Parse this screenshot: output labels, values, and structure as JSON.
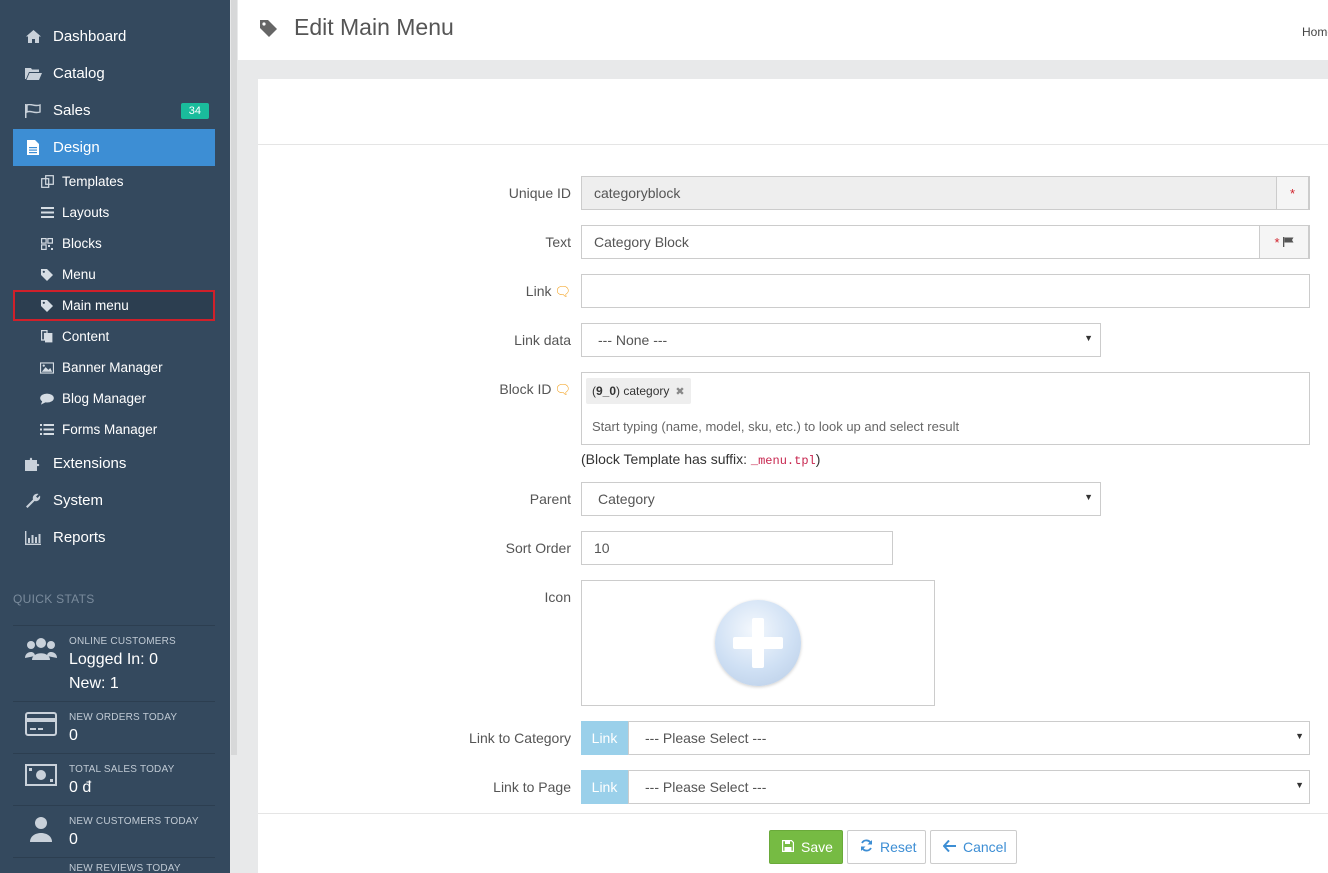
{
  "sidebar": {
    "nav": [
      {
        "label": "Dashboard",
        "icon": "home-icon"
      },
      {
        "label": "Catalog",
        "icon": "folder-open-icon"
      },
      {
        "label": "Sales",
        "icon": "flag-icon",
        "badge": "34"
      },
      {
        "label": "Design",
        "icon": "file-icon"
      }
    ],
    "design_sub": [
      {
        "label": "Templates",
        "icon": "templates-icon"
      },
      {
        "label": "Layouts",
        "icon": "bars-icon"
      },
      {
        "label": "Blocks",
        "icon": "qrcode-icon"
      },
      {
        "label": "Menu",
        "icon": "tag-icon"
      },
      {
        "label": "Main menu",
        "icon": "tag-icon"
      },
      {
        "label": "Content",
        "icon": "copy-icon"
      },
      {
        "label": "Banner Manager",
        "icon": "image-icon"
      },
      {
        "label": "Blog Manager",
        "icon": "comment-icon"
      },
      {
        "label": "Forms Manager",
        "icon": "list-icon"
      }
    ],
    "nav_bottom": [
      {
        "label": "Extensions",
        "icon": "puzzle-icon"
      },
      {
        "label": "System",
        "icon": "wrench-icon"
      },
      {
        "label": "Reports",
        "icon": "bar-chart-icon"
      }
    ],
    "quick_stats_title": "QUICK STATS",
    "stats": [
      {
        "label": "ONLINE CUSTOMERS",
        "line1": "Logged In: 0",
        "line2": "New: 1"
      },
      {
        "label": "NEW ORDERS TODAY",
        "value": "0"
      },
      {
        "label": "TOTAL SALES TODAY",
        "value": "0 đ"
      },
      {
        "label": "NEW CUSTOMERS TODAY",
        "value": "0"
      },
      {
        "label": "NEW REVIEWS TODAY"
      }
    ]
  },
  "header": {
    "title": "Edit Main Menu",
    "breadcrumb": "Home"
  },
  "form": {
    "unique_id": {
      "label": "Unique ID",
      "value": "categoryblock",
      "required": "*"
    },
    "text": {
      "label": "Text",
      "value": "Category Block",
      "required": "*"
    },
    "link": {
      "label": "Link",
      "value": ""
    },
    "link_data": {
      "label": "Link data",
      "value": "--- None ---"
    },
    "block_id": {
      "label": "Block ID",
      "tag_id": "9_0",
      "tag_name": "category",
      "placeholder": "Start typing (name, model, sku, etc.) to look up and select result",
      "hint_prefix": "(Block Template has suffix: ",
      "hint_code": "_menu.tpl",
      "hint_suffix": ")"
    },
    "parent": {
      "label": "Parent",
      "value": "Category"
    },
    "sort_order": {
      "label": "Sort Order",
      "value": "10"
    },
    "icon": {
      "label": "Icon"
    },
    "link_to_category": {
      "label": "Link to Category",
      "button": "Link",
      "value": "--- Please Select ---"
    },
    "link_to_page": {
      "label": "Link to Page",
      "button": "Link",
      "value": "--- Please Select ---"
    }
  },
  "buttons": {
    "save": "Save",
    "reset": "Reset",
    "cancel": "Cancel"
  },
  "colors": {
    "sidebar_bg": "#34495e",
    "active_nav": "#3d8ed4",
    "badge": "#1abc9c",
    "save_button": "#76bb43",
    "link_addon": "#9ad0ea",
    "highlight_border": "#d0202a"
  }
}
